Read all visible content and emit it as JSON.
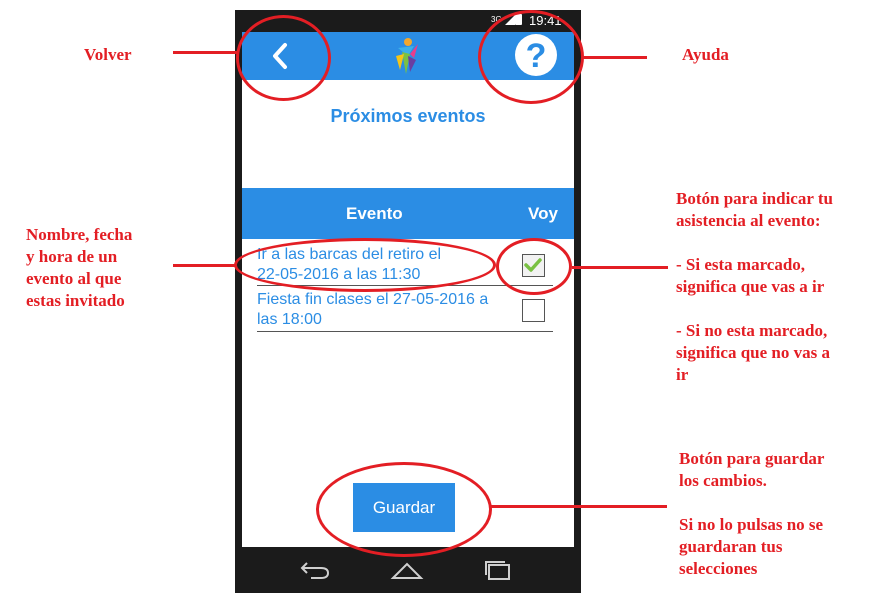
{
  "status_bar": {
    "network": "3G",
    "time": "19:41"
  },
  "app_bar": {
    "back_icon": "back-arrow-icon",
    "logo_icon": "app-logo-icon",
    "help_label": "?"
  },
  "page": {
    "title": "Próximos eventos"
  },
  "table": {
    "headers": {
      "event": "Evento",
      "attend": "Voy"
    },
    "rows": [
      {
        "text_line1": "Ir a las barcas del retiro el",
        "text_line2": "22-05-2016 a las 11:30",
        "attending": true
      },
      {
        "text_line1": "Fiesta fin clases el 27-05-2016 a",
        "text_line2": "las 18:00",
        "attending": false
      }
    ]
  },
  "save_button": {
    "label": "Guardar"
  },
  "nav_bar": {
    "icons": [
      "nav-back-icon",
      "nav-home-icon",
      "nav-recents-icon"
    ]
  },
  "annotations": {
    "volver": "Volver",
    "ayuda": "Ayuda",
    "event_desc": [
      "Nombre, fecha",
      "y hora de un",
      "evento al que",
      "estas invitado"
    ],
    "checkbox_desc": [
      "Botón para indicar tu",
      "asistencia al evento:",
      "",
      "- Si esta marcado,",
      "significa que vas a ir",
      "",
      "- Si no esta marcado,",
      "significa que no vas a",
      "ir"
    ],
    "save_desc": [
      "Botón para guardar",
      "los cambios.",
      "",
      "Si no lo pulsas no se",
      "guardaran tus",
      "selecciones"
    ]
  },
  "colors": {
    "accent": "#2b8de4",
    "annotation": "#e31e24",
    "phone_frame": "#1b1b1b"
  }
}
